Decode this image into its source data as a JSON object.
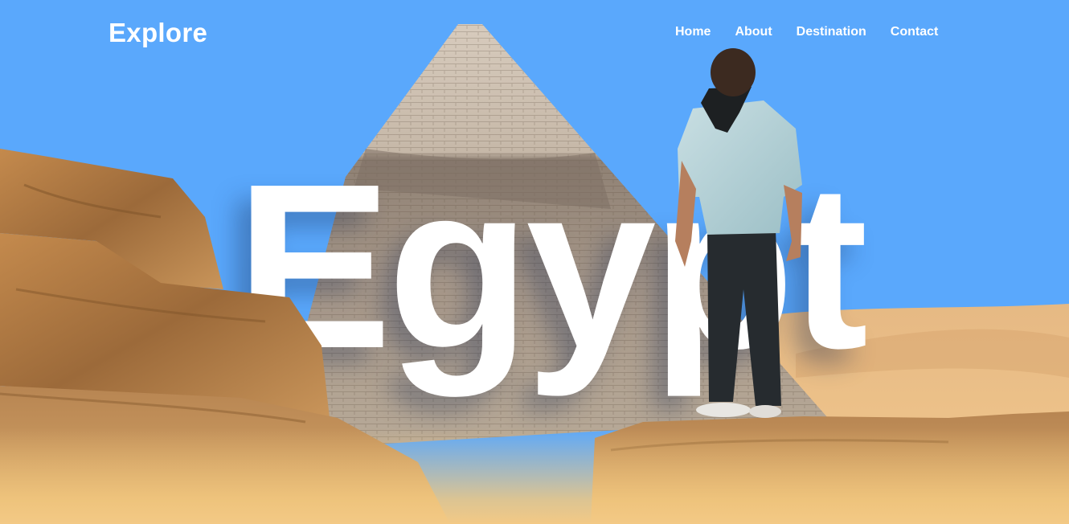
{
  "header": {
    "logo": "Explore",
    "nav": [
      {
        "label": "Home"
      },
      {
        "label": "About"
      },
      {
        "label": "Destination"
      },
      {
        "label": "Contact"
      }
    ]
  },
  "hero": {
    "title": "Egypt"
  },
  "colors": {
    "sky": "#5aa8fc",
    "text": "#ffffff",
    "sand": "#f3c985",
    "pyramid": "#b4a79a",
    "rock": "#b07a45"
  }
}
